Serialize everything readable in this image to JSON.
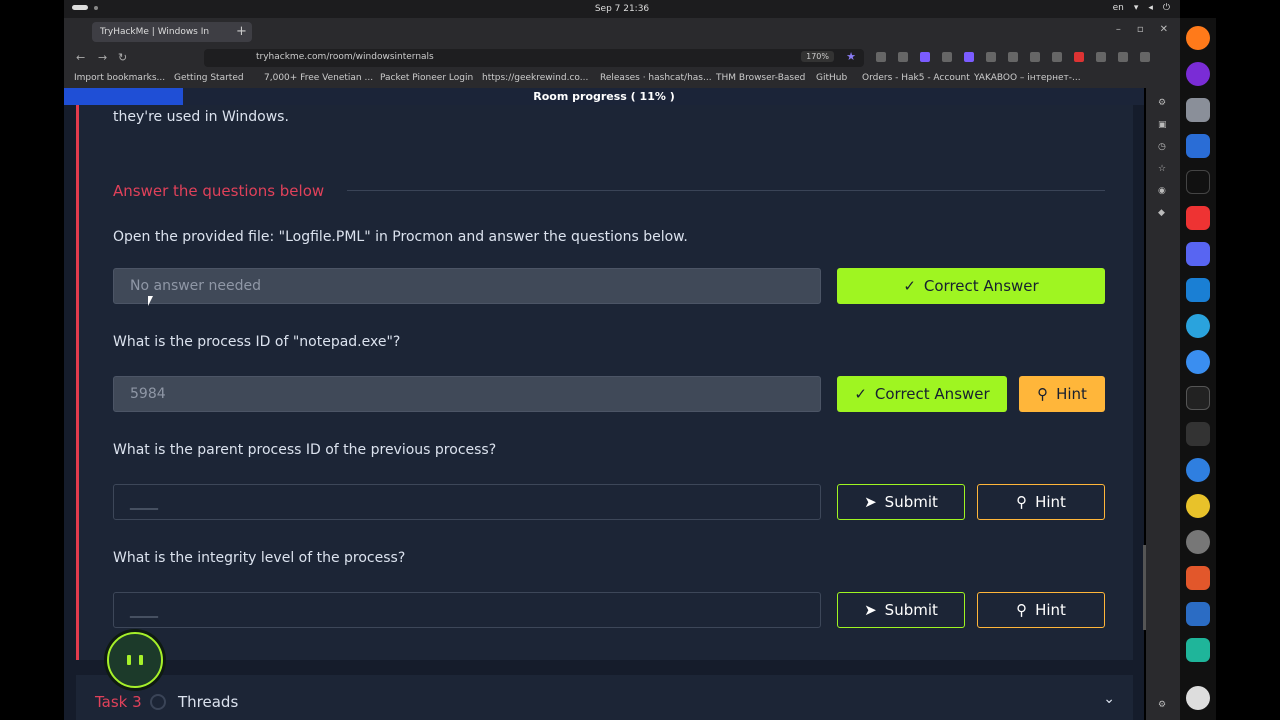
{
  "system": {
    "clock": "Sep 7  21:36",
    "lang": "en"
  },
  "browser": {
    "tab_title": "TryHackMe | Windows In",
    "url": "tryhackme.com/room/windowsinternals",
    "zoom": "170%",
    "bookmarks": [
      "Import bookmarks...",
      "Getting Started",
      "7,000+ Free Venetian ...",
      "Packet Pioneer Login",
      "https://geekrewind.co...",
      "Releases · hashcat/has...",
      "THM Browser-Based",
      "GitHub",
      "Orders - Hak5 - Account",
      "YAKABOO – інтернет-..."
    ]
  },
  "room": {
    "progress_label": "Room progress ( 11% )",
    "progress_value": 0.11,
    "prev_text": "they're used in Windows.",
    "section_title": "Answer the questions below",
    "questions": [
      {
        "text": "Open the provided file: \"Logfile.PML\" in Procmon and answer the questions below.",
        "value": "No answer needed",
        "button": "Correct Answer"
      },
      {
        "text": "What is the process ID of \"notepad.exe\"?",
        "value": "5984",
        "button": "Correct Answer",
        "hint": "Hint"
      },
      {
        "text": "What is the parent process ID of the previous process?",
        "placeholder": "____",
        "button": "Submit",
        "hint": "Hint"
      },
      {
        "text": "What is the integrity level of the process?",
        "placeholder": "____",
        "button": "Submit",
        "hint": "Hint"
      }
    ],
    "next_task": {
      "label": "Task 3",
      "title": "Threads"
    }
  },
  "colors": {
    "accent_green": "#9ff521",
    "hint_orange": "#ffb63a",
    "task_red": "#e0415a",
    "progress_blue": "#1f4fd6"
  }
}
